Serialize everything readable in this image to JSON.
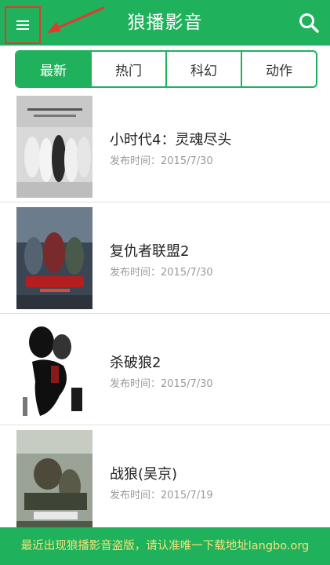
{
  "header": {
    "title": "狼播影音",
    "menu_icon": "hamburger-menu-icon",
    "search_icon": "search-icon",
    "accent_color": "#1fb15c",
    "annotation_color": "#e33a2c"
  },
  "tabs": [
    {
      "label": "最新",
      "active": true
    },
    {
      "label": "热门",
      "active": false
    },
    {
      "label": "科幻",
      "active": false
    },
    {
      "label": "动作",
      "active": false
    }
  ],
  "movies": [
    {
      "title": "小时代4：灵魂尽头",
      "date": "发布时间：2015/7/30"
    },
    {
      "title": "复仇者联盟2",
      "date": "发布时间：2015/7/30"
    },
    {
      "title": "杀破狼2",
      "date": "发布时间：2015/7/30"
    },
    {
      "title": "战狼(吴京)",
      "date": "发布时间：2015/7/19"
    }
  ],
  "banner": {
    "text": "最近出现狼播影音盗版，请认准唯一下载地址langbo.org",
    "text_color": "#f3e37c"
  }
}
